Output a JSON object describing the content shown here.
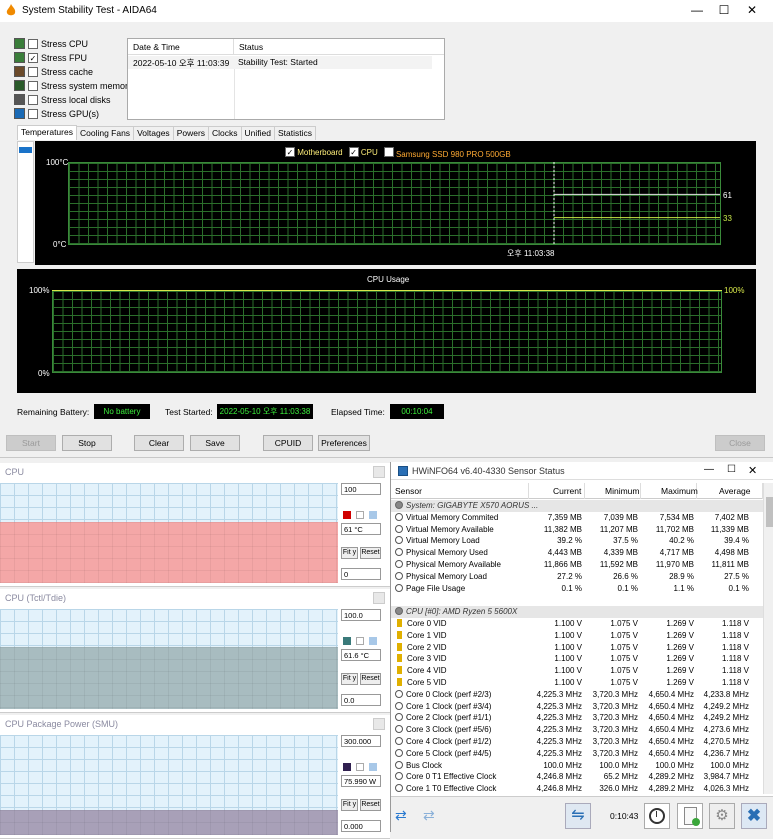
{
  "aida": {
    "title": "System Stability Test - AIDA64",
    "stress_items": [
      {
        "label": "Stress CPU",
        "checked": false
      },
      {
        "label": "Stress FPU",
        "checked": true
      },
      {
        "label": "Stress cache",
        "checked": false
      },
      {
        "label": "Stress system memory",
        "checked": false
      },
      {
        "label": "Stress local disks",
        "checked": false
      },
      {
        "label": "Stress GPU(s)",
        "checked": false
      }
    ],
    "table": {
      "col_date": "Date & Time",
      "col_status": "Status",
      "row_date": "2022-05-10 오후 11:03:39",
      "row_status": "Stability Test: Started"
    },
    "tabs": [
      "Temperatures",
      "Cooling Fans",
      "Voltages",
      "Powers",
      "Clocks",
      "Unified",
      "Statistics"
    ],
    "temp_chart": {
      "legend": [
        "Motherboard",
        "CPU",
        "Samsung SSD 980 PRO 500GB"
      ],
      "y_top": "100°C",
      "y_bottom": "0°C",
      "time": "오후 11:03:38",
      "val_mb": "61",
      "val_cpu": "33",
      "series_color_mb": "#e8e8e8",
      "series_color_cpu": "#c8e84a"
    },
    "cpu_chart": {
      "title": "CPU Usage",
      "y_top": "100%",
      "y_bottom": "0%",
      "val": "100%"
    },
    "status": {
      "battery_label": "Remaining Battery:",
      "battery_value": "No battery",
      "started_label": "Test Started:",
      "started_value": "2022-05-10 오후 11:03:38",
      "elapsed_label": "Elapsed Time:",
      "elapsed_value": "00:10:04"
    },
    "buttons": {
      "start": "Start",
      "stop": "Stop",
      "clear": "Clear",
      "save": "Save",
      "cpuid": "CPUID",
      "prefs": "Preferences",
      "close": "Close"
    }
  },
  "monitors": [
    {
      "title": "CPU",
      "max": "100",
      "value": "61 °C",
      "min": "0",
      "fill_color": "#f4a7a7",
      "swatch": "#d00000",
      "fill_fraction": 0.61
    },
    {
      "title": "CPU (Tctl/Tdie)",
      "max": "100.0",
      "value": "61.6 °C",
      "min": "0.0",
      "fill_color": "#a8bcc0",
      "swatch": "#3a7a7a",
      "fill_fraction": 0.616
    },
    {
      "title": "CPU Package Power (SMU)",
      "max": "300.000",
      "value": "75.990 W",
      "min": "0.000",
      "fill_color": "#a8a0b8",
      "swatch": "#302050",
      "fill_fraction": 0.253
    }
  ],
  "monitor_buttons": {
    "fit": "Fit y",
    "reset": "Reset"
  },
  "hwinfo": {
    "title": "HWiNFO64 v6.40-4330 Sensor Status",
    "headers": [
      "Sensor",
      "Current",
      "Minimum",
      "Maximum",
      "Average"
    ],
    "rows": [
      {
        "group": true,
        "name": "System: GIGABYTE X570 AORUS ..."
      },
      {
        "name": "Virtual Memory Commited",
        "cur": "7,359 MB",
        "min": "7,039 MB",
        "max": "7,534 MB",
        "avg": "7,402 MB"
      },
      {
        "name": "Virtual Memory Available",
        "cur": "11,382 MB",
        "min": "11,207 MB",
        "max": "11,702 MB",
        "avg": "11,339 MB"
      },
      {
        "name": "Virtual Memory Load",
        "cur": "39.2 %",
        "min": "37.5 %",
        "max": "40.2 %",
        "avg": "39.4 %"
      },
      {
        "name": "Physical Memory Used",
        "cur": "4,443 MB",
        "min": "4,339 MB",
        "max": "4,717 MB",
        "avg": "4,498 MB"
      },
      {
        "name": "Physical Memory Available",
        "cur": "11,866 MB",
        "min": "11,592 MB",
        "max": "11,970 MB",
        "avg": "11,811 MB"
      },
      {
        "name": "Physical Memory Load",
        "cur": "27.2 %",
        "min": "26.6 %",
        "max": "28.9 %",
        "avg": "27.5 %"
      },
      {
        "name": "Page File Usage",
        "cur": "0.1 %",
        "min": "0.1 %",
        "max": "1.1 %",
        "avg": "0.1 %"
      },
      {
        "spacer": true
      },
      {
        "group": true,
        "name": "CPU [#0]: AMD Ryzen 5 5600X"
      },
      {
        "name": "Core 0 VID",
        "v": true,
        "cur": "1.100 V",
        "min": "1.075 V",
        "max": "1.269 V",
        "avg": "1.118 V"
      },
      {
        "name": "Core 1 VID",
        "v": true,
        "cur": "1.100 V",
        "min": "1.075 V",
        "max": "1.269 V",
        "avg": "1.118 V"
      },
      {
        "name": "Core 2 VID",
        "v": true,
        "cur": "1.100 V",
        "min": "1.075 V",
        "max": "1.269 V",
        "avg": "1.118 V"
      },
      {
        "name": "Core 3 VID",
        "v": true,
        "cur": "1.100 V",
        "min": "1.075 V",
        "max": "1.269 V",
        "avg": "1.118 V"
      },
      {
        "name": "Core 4 VID",
        "v": true,
        "cur": "1.100 V",
        "min": "1.075 V",
        "max": "1.269 V",
        "avg": "1.118 V"
      },
      {
        "name": "Core 5 VID",
        "v": true,
        "cur": "1.100 V",
        "min": "1.075 V",
        "max": "1.269 V",
        "avg": "1.118 V"
      },
      {
        "name": "Core 0 Clock (perf #2/3)",
        "cur": "4,225.3 MHz",
        "min": "3,720.3 MHz",
        "max": "4,650.4 MHz",
        "avg": "4,233.8 MHz"
      },
      {
        "name": "Core 1 Clock (perf #3/4)",
        "cur": "4,225.3 MHz",
        "min": "3,720.3 MHz",
        "max": "4,650.4 MHz",
        "avg": "4,249.2 MHz"
      },
      {
        "name": "Core 2 Clock (perf #1/1)",
        "cur": "4,225.3 MHz",
        "min": "3,720.3 MHz",
        "max": "4,650.4 MHz",
        "avg": "4,249.2 MHz"
      },
      {
        "name": "Core 3 Clock (perf #5/6)",
        "cur": "4,225.3 MHz",
        "min": "3,720.3 MHz",
        "max": "4,650.4 MHz",
        "avg": "4,273.6 MHz"
      },
      {
        "name": "Core 4 Clock (perf #1/2)",
        "cur": "4,225.3 MHz",
        "min": "3,720.3 MHz",
        "max": "4,650.4 MHz",
        "avg": "4,270.5 MHz"
      },
      {
        "name": "Core 5 Clock (perf #4/5)",
        "cur": "4,225.3 MHz",
        "min": "3,720.3 MHz",
        "max": "4,650.4 MHz",
        "avg": "4,236.7 MHz"
      },
      {
        "name": "Bus Clock",
        "cur": "100.0 MHz",
        "min": "100.0 MHz",
        "max": "100.0 MHz",
        "avg": "100.0 MHz"
      },
      {
        "name": "Core 0 T1 Effective Clock",
        "cur": "4,246.8 MHz",
        "min": "65.2 MHz",
        "max": "4,289.2 MHz",
        "avg": "3,984.7 MHz"
      },
      {
        "name": "Core 1 T0 Effective Clock",
        "cur": "4,246.8 MHz",
        "min": "326.0 MHz",
        "max": "4,289.2 MHz",
        "avg": "4,026.3 MHz"
      }
    ],
    "timer": "0:10:43"
  }
}
